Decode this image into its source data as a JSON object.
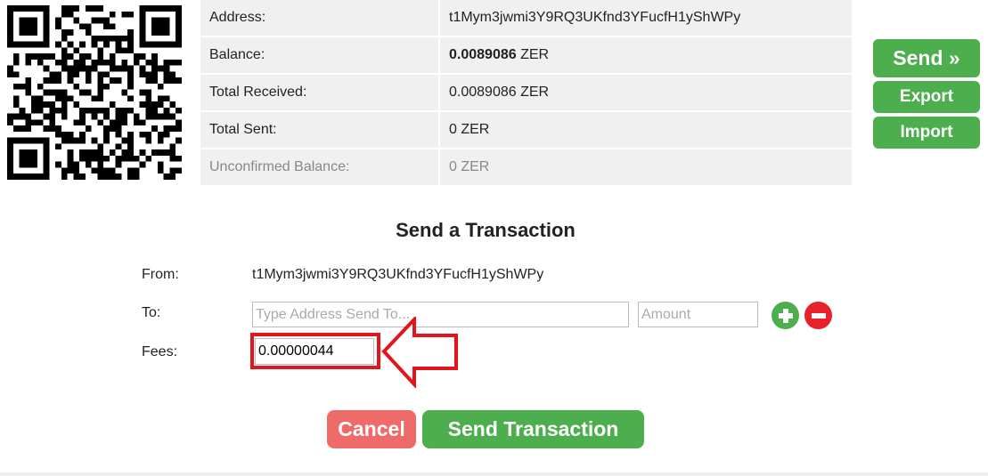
{
  "wallet": {
    "rows": [
      {
        "label": "Address:",
        "value": "t1Mym3jwmi3Y9RQ3UKfnd3YFucfH1yShWPy",
        "bold": "",
        "unit": ""
      },
      {
        "label": "Balance:",
        "value": "",
        "bold": "0.0089086",
        "unit": " ZER"
      },
      {
        "label": "Total Received:",
        "value": "0.0089086 ZER",
        "bold": "",
        "unit": ""
      },
      {
        "label": "Total Sent:",
        "value": "0 ZER",
        "bold": "",
        "unit": ""
      },
      {
        "label": "Unconfirmed Balance:",
        "value": "0 ZER",
        "bold": "",
        "unit": ""
      }
    ]
  },
  "actions": {
    "send_label": "Send »",
    "export_label": "Export",
    "import_label": "Import"
  },
  "form": {
    "title": "Send a Transaction",
    "from_label": "From:",
    "from_value": "t1Mym3jwmi3Y9RQ3UKfnd3YFucfH1yShWPy",
    "to_label": "To:",
    "to_placeholder": "Type Address Send To...",
    "amount_placeholder": "Amount",
    "fees_label": "Fees:",
    "fees_value": "0.00000044",
    "cancel_label": "Cancel",
    "send_tx_label": "Send Transaction"
  },
  "icons": {
    "add": "plus-circle-icon",
    "remove": "minus-circle-icon",
    "annotation": "left-arrow-icon"
  },
  "colors": {
    "green": "#4cae4c",
    "red": "#e8212a",
    "cancel": "#ee6b69",
    "highlight": "#e2151c"
  }
}
